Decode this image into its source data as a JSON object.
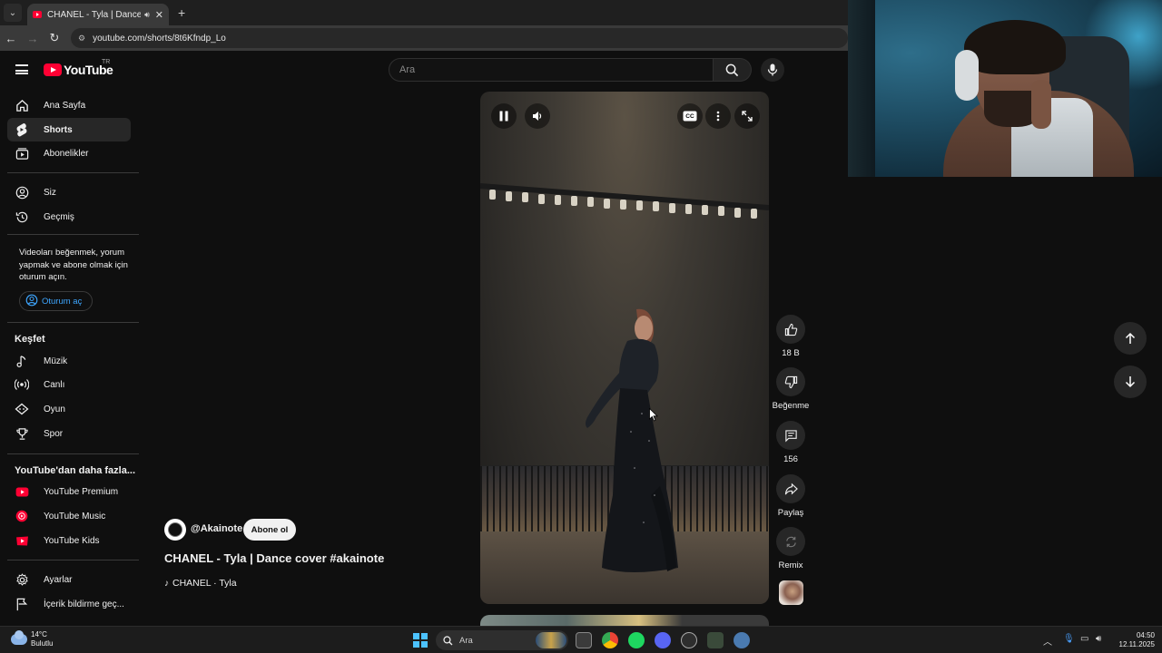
{
  "browser": {
    "tab_title": "CHANEL - Tyla | Dance cove",
    "url": "youtube.com/shorts/8t6Kfndp_Lo"
  },
  "header": {
    "logo_text": "YouTube",
    "region": "TR",
    "search_placeholder": "Ara"
  },
  "sidebar": {
    "items": [
      {
        "label": "Ana Sayfa",
        "icon": "home-icon"
      },
      {
        "label": "Shorts",
        "icon": "shorts-icon",
        "active": true
      },
      {
        "label": "Abonelikler",
        "icon": "subscriptions-icon"
      }
    ],
    "you_items": [
      {
        "label": "Siz",
        "icon": "account-icon"
      },
      {
        "label": "Geçmiş",
        "icon": "history-icon"
      }
    ],
    "signin_prompt": "Videoları beğenmek, yorum yapmak ve abone olmak için oturum açın.",
    "signin_button": "Oturum aç",
    "explore_heading": "Keşfet",
    "explore_items": [
      {
        "label": "Müzik",
        "icon": "music-icon"
      },
      {
        "label": "Canlı",
        "icon": "live-icon"
      },
      {
        "label": "Oyun",
        "icon": "gaming-icon"
      },
      {
        "label": "Spor",
        "icon": "trophy-icon"
      }
    ],
    "more_heading": "YouTube'dan daha fazla...",
    "more_items": [
      {
        "label": "YouTube Premium",
        "icon": "youtube-premium-icon"
      },
      {
        "label": "YouTube Music",
        "icon": "youtube-music-icon"
      },
      {
        "label": "YouTube Kids",
        "icon": "youtube-kids-icon"
      }
    ],
    "bottom_items": [
      {
        "label": "Ayarlar",
        "icon": "settings-icon"
      },
      {
        "label": "İçerik bildirme geç...",
        "icon": "flag-icon"
      }
    ]
  },
  "video": {
    "channel_handle": "@Akainote",
    "subscribe_label": "Abone ol",
    "title": "CHANEL - Tyla | Dance cover #akainote",
    "audio": "CHANEL · Tyla",
    "controls": {
      "captions_label": "CC"
    }
  },
  "actions": {
    "like_count": "18 B",
    "dislike_label": "Beğenme",
    "comment_count": "156",
    "share_label": "Paylaş",
    "remix_label": "Remix"
  },
  "taskbar": {
    "temperature": "14°C",
    "weather": "Bulutlu",
    "search_placeholder": "Ara",
    "time": "04:50",
    "date": "12.11.2025"
  },
  "colors": {
    "accent_red": "#ff0033",
    "link_blue": "#3ea6ff",
    "background": "#0f0f0f"
  }
}
